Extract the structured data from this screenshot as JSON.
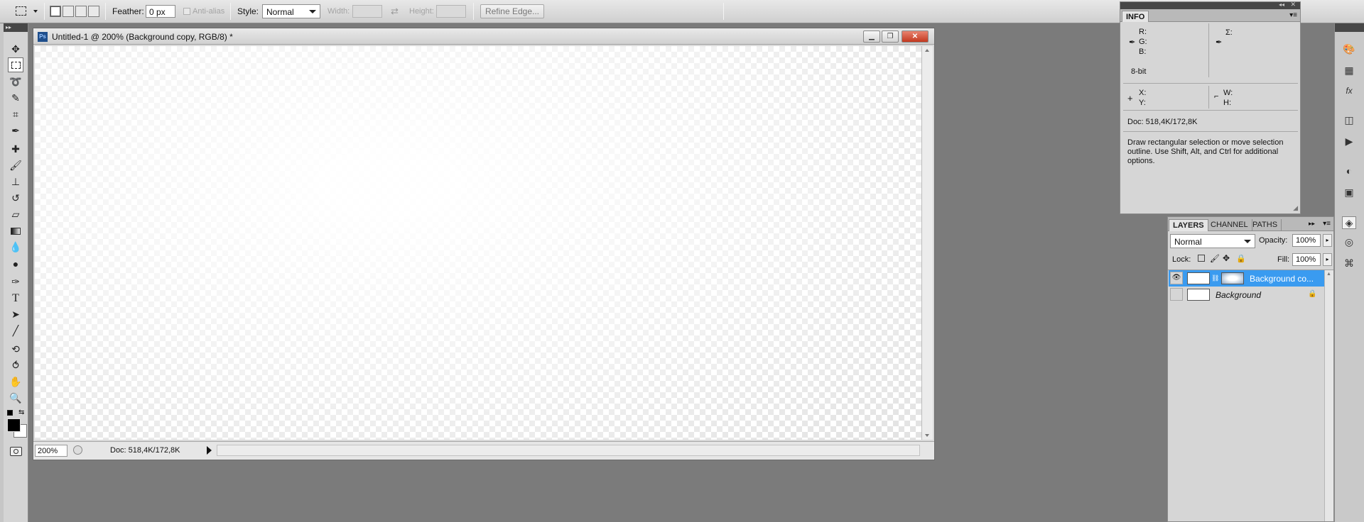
{
  "options_bar": {
    "feather_label": "Feather:",
    "feather_value": "0 px",
    "anti_alias_label": "Anti-alias",
    "style_label": "Style:",
    "style_value": "Normal",
    "width_label": "Width:",
    "height_label": "Height:",
    "refine_edge_label": "Refine Edge..."
  },
  "document": {
    "title": "Untitled-1 @ 200% (Background copy, RGB/8) *",
    "app_badge": "Ps",
    "zoom": "200%",
    "doc_info": "Doc: 518,4K/172,8K",
    "minimize_icon": "minimize-icon",
    "maximize_icon": "maximize-icon",
    "close_icon": "close-icon"
  },
  "info_panel": {
    "tab": "INFO",
    "r_label": "R:",
    "g_label": "G:",
    "b_label": "B:",
    "sigma_label": "Σ:",
    "bit_depth": "8-bit",
    "x_label": "X:",
    "y_label": "Y:",
    "w_label": "W:",
    "h_label": "H:",
    "doc_info": "Doc: 518,4K/172,8K",
    "hint": "Draw rectangular selection or move selection outline.  Use Shift, Alt, and Ctrl for additional options."
  },
  "layers_panel": {
    "tabs": [
      "LAYERS",
      "CHANNEL",
      "PATHS"
    ],
    "blend_mode": "Normal",
    "opacity_label": "Opacity:",
    "opacity_value": "100%",
    "lock_label": "Lock:",
    "fill_label": "Fill:",
    "fill_value": "100%",
    "layers": [
      {
        "name": "Background co...",
        "visible": true,
        "selected": true
      },
      {
        "name": "Background",
        "visible": false,
        "selected": false,
        "locked": true
      }
    ]
  },
  "tools": [
    "move-tool-icon",
    "rectangular-marquee-icon",
    "lasso-icon",
    "quick-selection-icon",
    "crop-icon",
    "eyedropper-icon",
    "healing-brush-icon",
    "brush-icon",
    "clone-stamp-icon",
    "history-brush-icon",
    "eraser-icon",
    "gradient-icon",
    "blur-icon",
    "dodge-icon",
    "pen-icon",
    "type-icon",
    "path-selection-icon",
    "line-icon",
    "3d-rotate-icon",
    "3d-orbit-icon",
    "hand-icon",
    "zoom-icon"
  ],
  "colors": {
    "workspace": "#7b7b7b",
    "selected_layer": "#3a9bf0",
    "foreground": "#000000",
    "background": "#ffffff"
  }
}
